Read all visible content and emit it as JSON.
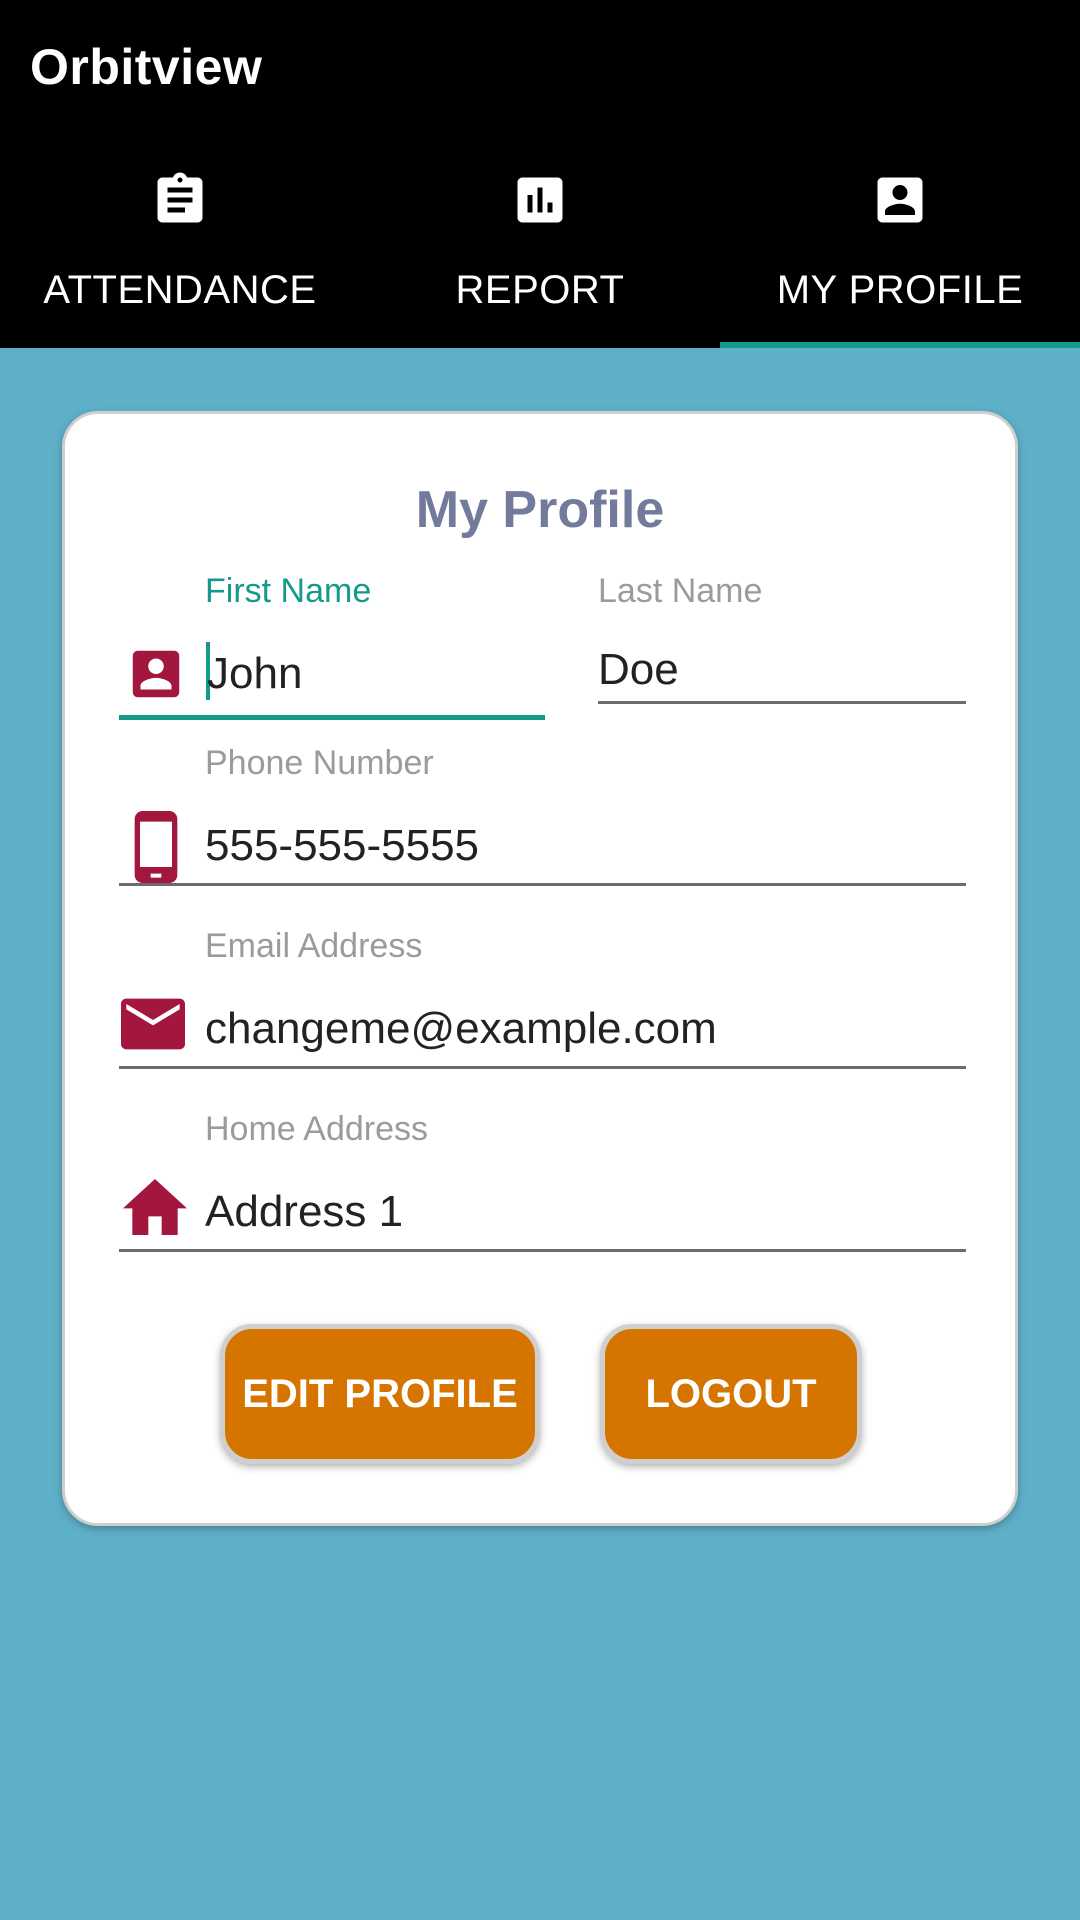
{
  "app": {
    "title": "Orbitview"
  },
  "tabs": [
    {
      "label": "ATTENDANCE",
      "icon": "clipboard-icon",
      "selected": false
    },
    {
      "label": "REPORT",
      "icon": "bar-chart-icon",
      "selected": false
    },
    {
      "label": "MY PROFILE",
      "icon": "profile-icon",
      "selected": true
    }
  ],
  "profile": {
    "title": "My Profile",
    "first_name": {
      "label": "First Name",
      "value": "John"
    },
    "last_name": {
      "label": "Last Name",
      "value": "Doe"
    },
    "phone": {
      "label": "Phone Number",
      "value": "555-555-5555"
    },
    "email": {
      "label": "Email Address",
      "value": "changeme@example.com"
    },
    "address": {
      "label": "Home Address",
      "value": "Address 1"
    }
  },
  "buttons": {
    "edit_label": "EDIT PROFILE",
    "logout_label": "LOGOUT"
  },
  "colors": {
    "appbar": "#000000",
    "background": "#5eafc8",
    "accent": "#14998a",
    "icon": "#a3163e",
    "button": "#d57500",
    "title": "#727b9c"
  }
}
